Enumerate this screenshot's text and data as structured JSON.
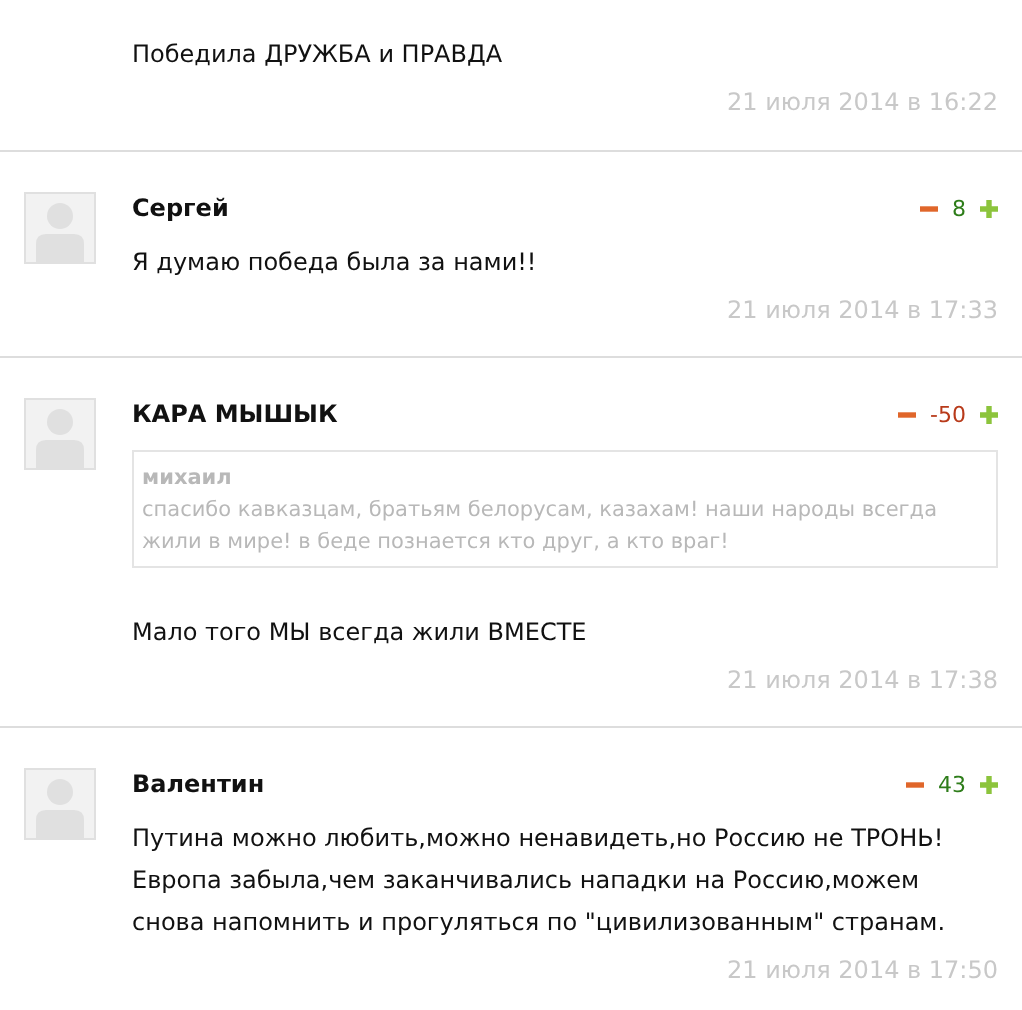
{
  "partial_comment": {
    "text": "Победила ДРУЖБА и ПРАВДА",
    "date": "21 июля 2014 в 16:22"
  },
  "comments": [
    {
      "author": "Сергей",
      "score": "8",
      "color": "#2e7d1a",
      "text": "Я думаю победа была за нами!!",
      "date": "21 июля 2014 в 17:33"
    },
    {
      "author": "КАРА МЫШЫК",
      "score": "-50",
      "color": "#b83a1a",
      "quote": {
        "author": "михаил",
        "text": "спасибо кавказцам, братьям белорусам, казахам! наши народы всегда жили в мире! в беде познается кто друг, а кто враг!"
      },
      "text": "Мало того МЫ всегда жили ВМЕСТЕ",
      "date": "21 июля 2014 в 17:38"
    },
    {
      "author": "Валентин",
      "score": "43",
      "color": "#2e7d1a",
      "text": "Путина можно любить,можно ненавидеть,но Россию не ТРОНЬ! Европа забыла,чем заканчивались нападки на Россию,можем снова напомнить и прогуляться по \"цивилизованным\" странам.",
      "date": "21 июля 2014 в 17:50"
    }
  ]
}
